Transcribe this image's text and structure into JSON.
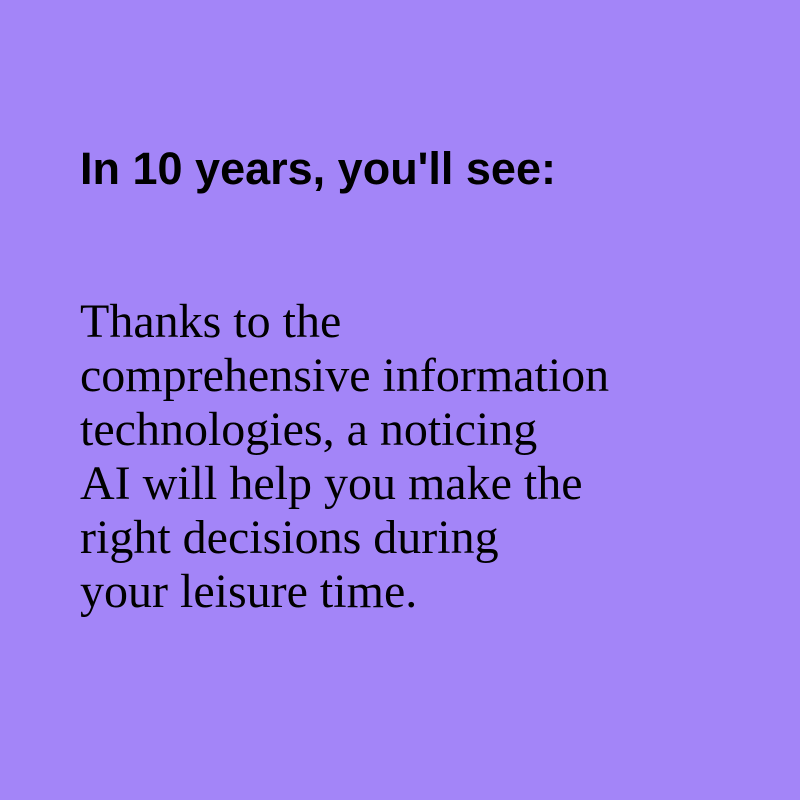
{
  "colors": {
    "background": "#a385f8",
    "text": "#000000"
  },
  "heading": "In 10 years, you'll see:",
  "body_lines": [
    "Thanks to the",
    "comprehensive information",
    "technologies, a noticing",
    "AI will help you make the",
    "right decisions during",
    "your leisure time."
  ]
}
